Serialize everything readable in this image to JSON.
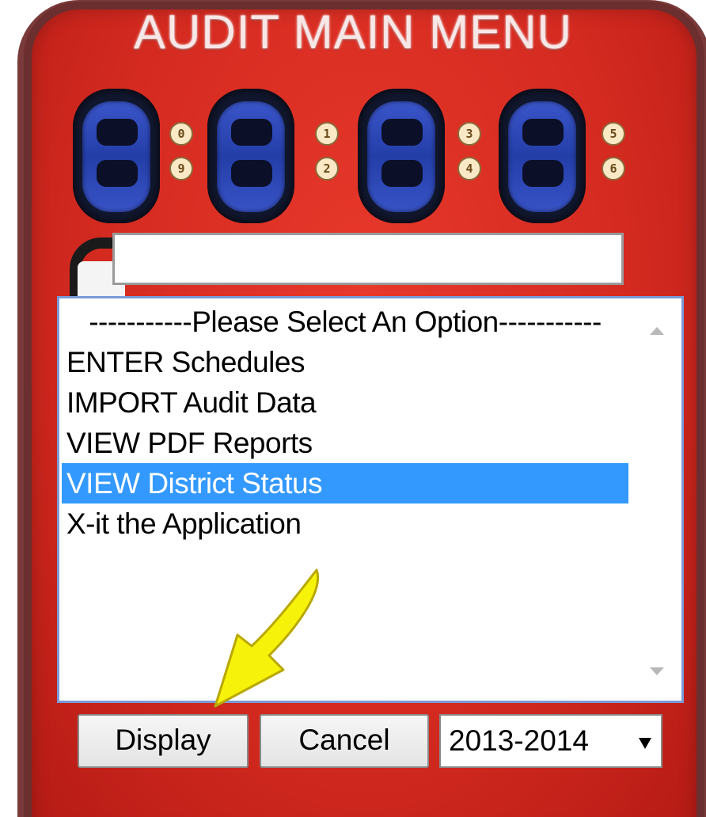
{
  "title": "AUDIT MAIN MENU",
  "pins": [
    "0",
    "9",
    "1",
    "2",
    "3",
    "4",
    "5",
    "6"
  ],
  "name_input": {
    "value": ""
  },
  "listbox": {
    "options": [
      "-----------Please Select An Option-----------",
      "ENTER Schedules",
      "IMPORT Audit Data",
      "VIEW PDF Reports",
      "VIEW District Status",
      "X-it the Application"
    ],
    "selected_index": 4
  },
  "buttons": {
    "display_label": "Display",
    "cancel_label": "Cancel"
  },
  "year_select": {
    "selected": "2013-2014"
  },
  "colors": {
    "device_red": "#d42a20",
    "selection": "#3399ff",
    "arrow_yellow": "#f7f20a"
  }
}
